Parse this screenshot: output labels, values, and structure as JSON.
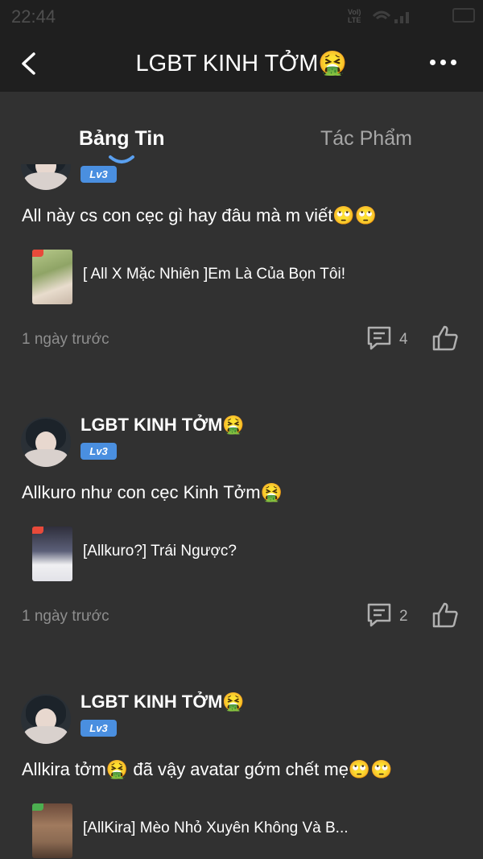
{
  "status_bar": {
    "time": "22:44",
    "network_label": "Vol) LTE"
  },
  "header": {
    "title": "LGBT KINH TỞM🤮"
  },
  "tabs": [
    {
      "label": "Bảng Tin",
      "active": true
    },
    {
      "label": "Tác Phẩm",
      "active": false
    }
  ],
  "posts": [
    {
      "author": "",
      "level": "Lv3",
      "text": "All này cs con cẹc gì hay đâu mà m viết🙄🙄",
      "book_title": "[ All X Mặc Nhiên ]Em Là Của Bọn Tôi!",
      "time_ago": "1 ngày trước",
      "comments": "4"
    },
    {
      "author": "LGBT KINH TỞM🤮",
      "level": "Lv3",
      "text": "Allkuro như con cẹc Kinh Tởm🤮",
      "book_title": "[Allkuro?] Trái Ngược?",
      "time_ago": "1 ngày trước",
      "comments": "2"
    },
    {
      "author": "LGBT KINH TỞM🤮",
      "level": "Lv3",
      "text": "Allkira tởm🤮 đã vậy avatar gớm chết mẹ🙄🙄",
      "book_title": "[AllKira] Mèo Nhỏ Xuyên Không Và B..."
    }
  ],
  "colors": {
    "background": "#313131",
    "header": "#1f1f1f",
    "level_badge": "#4a8fe0",
    "tab_indicator": "#5aa0f0"
  },
  "icons": [
    "back-arrow-icon",
    "more-dots-icon",
    "comment-icon",
    "thumbs-up-icon"
  ]
}
